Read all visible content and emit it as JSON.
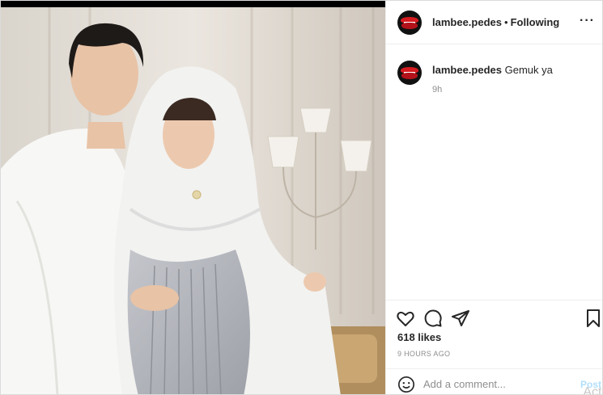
{
  "post": {
    "username": "lambee.pedes",
    "follow_status": "Following",
    "separator": "•",
    "more_icon": "more-icon",
    "comment": {
      "username": "lambee.pedes",
      "text": "Gemuk ya",
      "time": "9h"
    },
    "likes": "618 likes",
    "posted_ago": "9 HOURS AGO",
    "add_comment_placeholder": "Add a comment...",
    "post_label": "Post",
    "watermark_text": "Acti"
  },
  "icons": {
    "like": "heart-icon",
    "comment": "comment-icon",
    "share": "share-icon",
    "save": "bookmark-icon",
    "emoji": "emoji-icon"
  },
  "colors": {
    "accent_avatar_red": "#d61a1f",
    "text_primary": "#262626",
    "text_secondary": "#8e8e8e",
    "post_disabled": "#b2dffc"
  }
}
